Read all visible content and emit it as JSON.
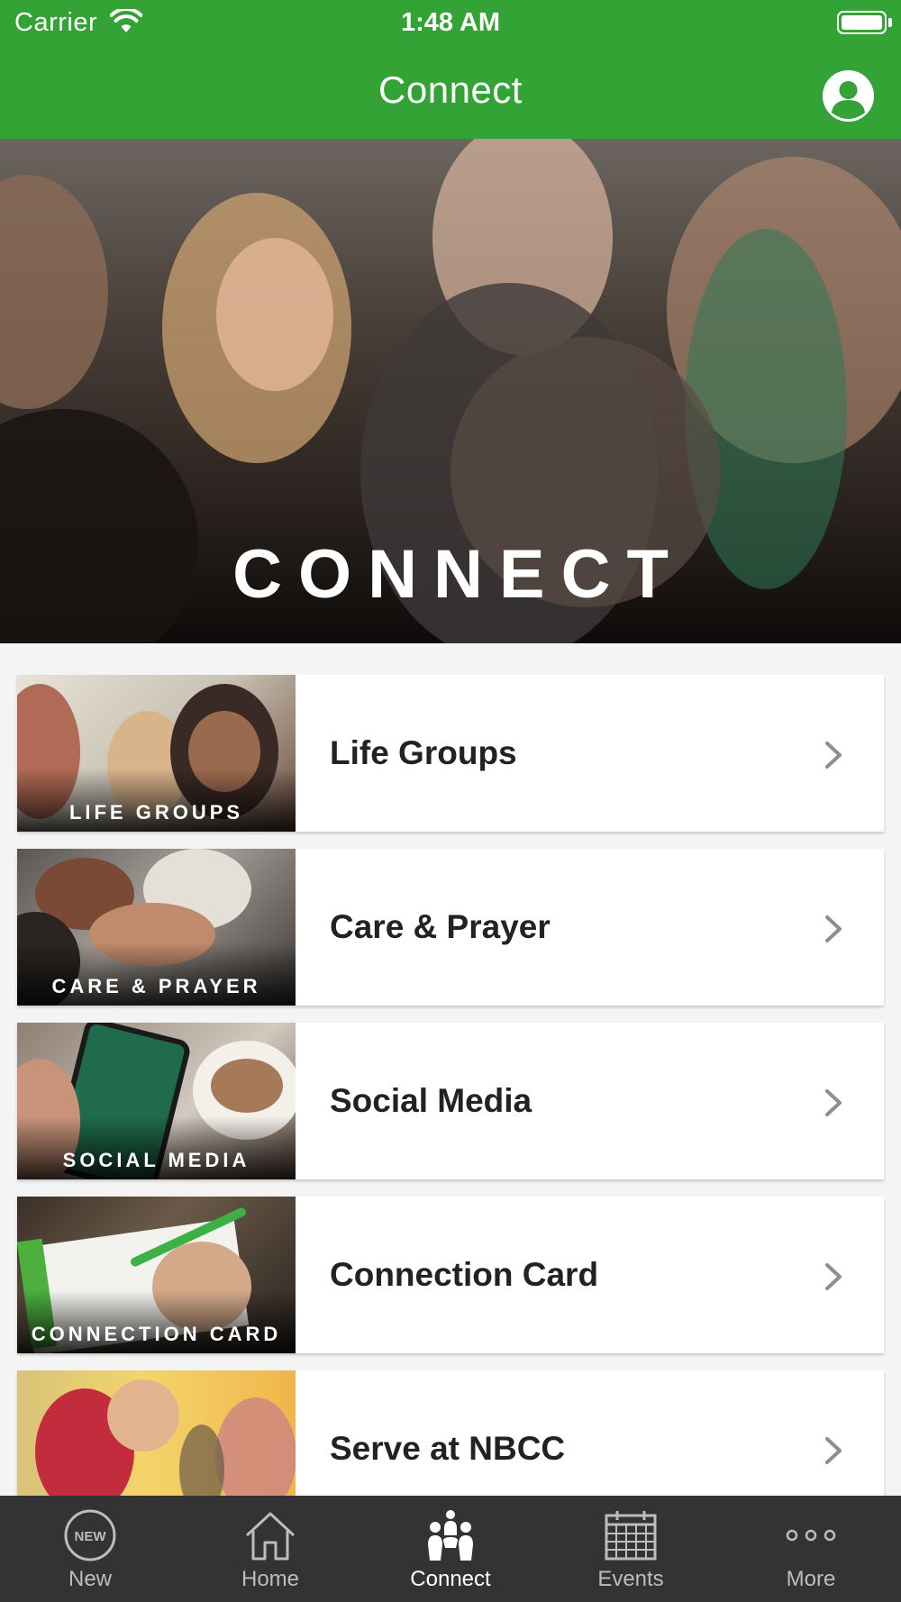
{
  "status_bar": {
    "carrier": "Carrier",
    "time": "1:48 AM"
  },
  "nav": {
    "title": "Connect",
    "profile_icon": "user-circle-icon"
  },
  "hero": {
    "title": "CONNECT"
  },
  "items": [
    {
      "thumb_caption": "LIFE GROUPS",
      "label": "Life Groups"
    },
    {
      "thumb_caption": "CARE & PRAYER",
      "label": "Care & Prayer"
    },
    {
      "thumb_caption": "SOCIAL MEDIA",
      "label": "Social Media"
    },
    {
      "thumb_caption": "CONNECTION CARD",
      "label": "Connection Card"
    },
    {
      "thumb_caption": "",
      "label": "Serve at NBCC"
    }
  ],
  "tabs": [
    {
      "label": "New",
      "icon": "new-badge-icon",
      "active": false
    },
    {
      "label": "Home",
      "icon": "home-icon",
      "active": false
    },
    {
      "label": "Connect",
      "icon": "people-group-icon",
      "active": true
    },
    {
      "label": "Events",
      "icon": "calendar-icon",
      "active": false
    },
    {
      "label": "More",
      "icon": "more-dots-icon",
      "active": false
    }
  ],
  "colors": {
    "brand_green": "#33a335",
    "tabbar_bg": "#333333",
    "tab_active": "#ffffff",
    "tab_inactive": "#bdbdbd"
  }
}
